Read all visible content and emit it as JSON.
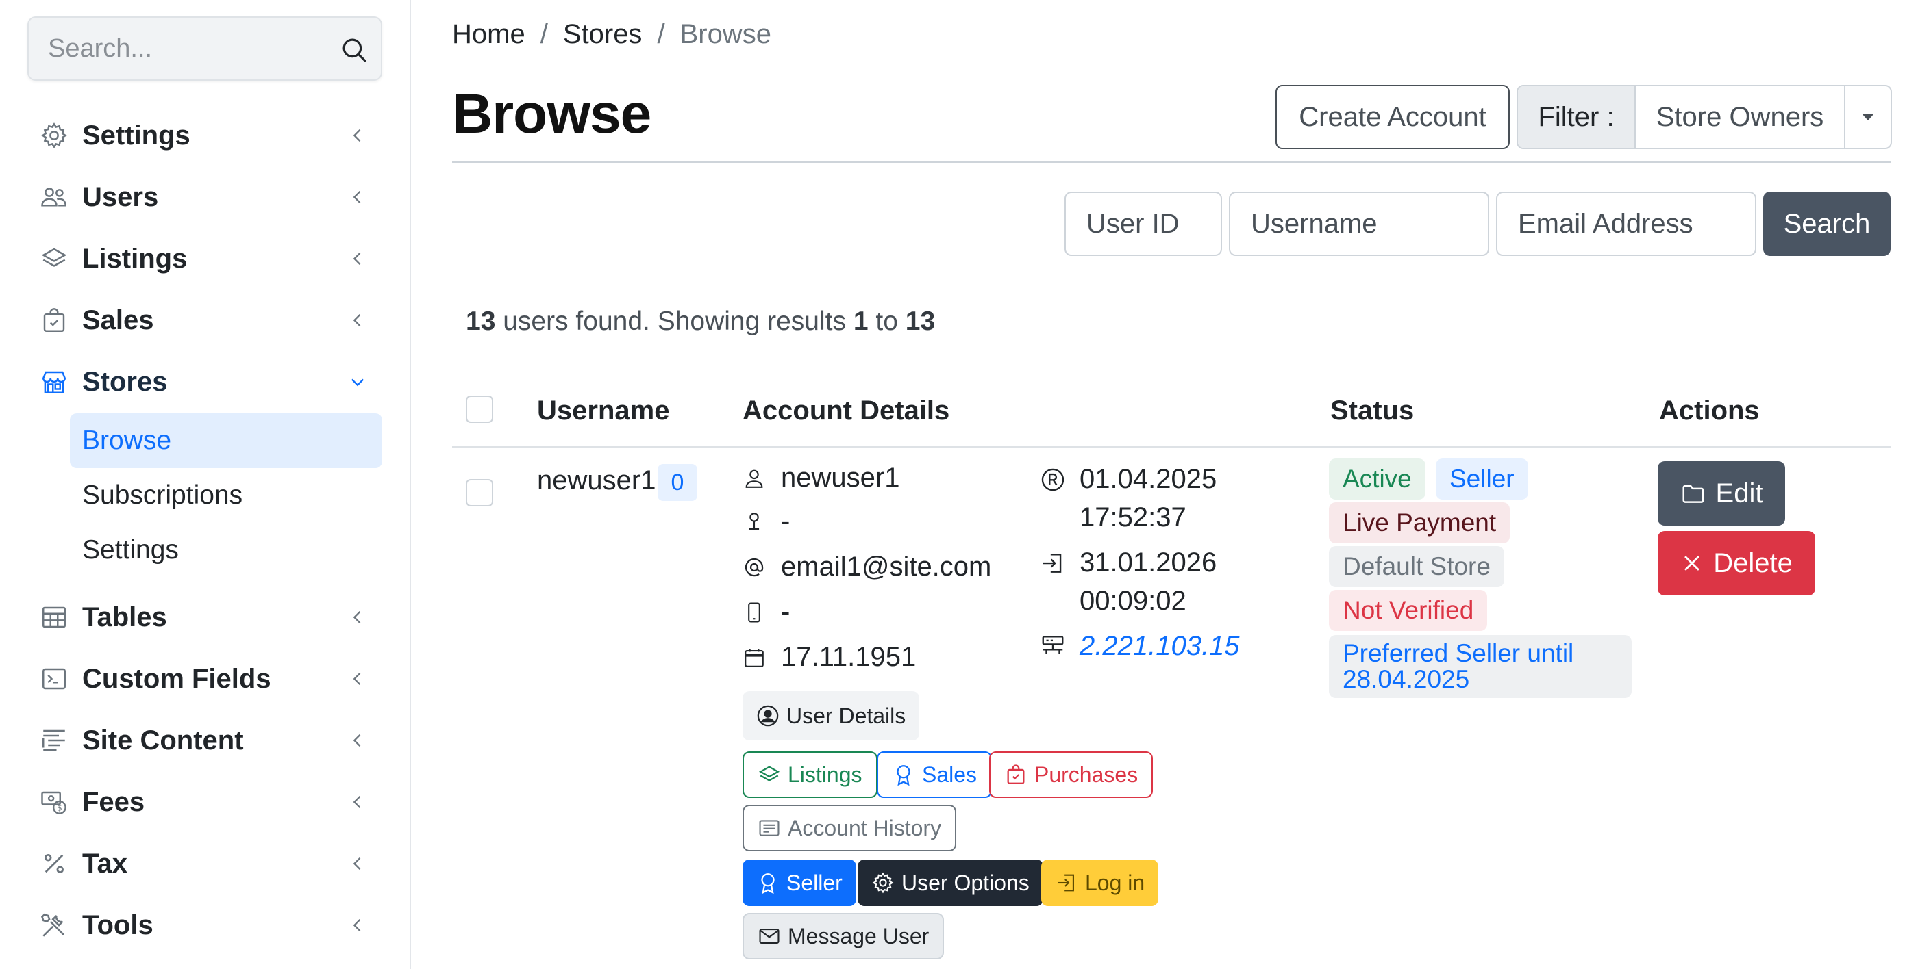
{
  "sidebar": {
    "search_placeholder": "Search...",
    "items": [
      {
        "label": "Settings",
        "icon": "gear-icon"
      },
      {
        "label": "Users",
        "icon": "users-icon"
      },
      {
        "label": "Listings",
        "icon": "layers-icon"
      },
      {
        "label": "Sales",
        "icon": "bag-check-icon"
      },
      {
        "label": "Stores",
        "icon": "shop-icon"
      },
      {
        "label": "Tables",
        "icon": "table-icon"
      },
      {
        "label": "Custom Fields",
        "icon": "terminal-icon"
      },
      {
        "label": "Site Content",
        "icon": "text-indent-icon"
      },
      {
        "label": "Fees",
        "icon": "cash-coin-icon"
      },
      {
        "label": "Tax",
        "icon": "percent-icon"
      },
      {
        "label": "Tools",
        "icon": "tools-icon"
      }
    ],
    "stores_sub": [
      {
        "label": "Browse"
      },
      {
        "label": "Subscriptions"
      },
      {
        "label": "Settings"
      }
    ]
  },
  "breadcrumb": {
    "home": "Home",
    "sep": "/",
    "stores": "Stores",
    "current": "Browse"
  },
  "page_title": "Browse",
  "toolbar": {
    "create_account": "Create Account",
    "filter_label": "Filter :",
    "filter_value": "Store Owners"
  },
  "search_form": {
    "user_id_placeholder": "User ID",
    "username_placeholder": "Username",
    "email_placeholder": "Email Address",
    "search_button": "Search"
  },
  "results": {
    "total": "13",
    "text1": " users found. Showing results ",
    "from": "1",
    "to_word": " to ",
    "to": "13"
  },
  "table": {
    "headers": {
      "username": "Username",
      "account_details": "Account Details",
      "status": "Status",
      "actions": "Actions"
    },
    "rows": [
      {
        "username": "newuser1",
        "count": "0",
        "details": {
          "name": "newuser1",
          "address": "-",
          "email": "email1@site.com",
          "phone": "-",
          "birthdate": "17.11.1951",
          "registered_date": "01.04.2025",
          "registered_time": "17:52:37",
          "last_login_date": "31.01.2026",
          "last_login_time": "00:09:02",
          "ip": "2.221.103.15"
        },
        "buttons": {
          "user_details": "User Details",
          "listings": "Listings",
          "sales": "Sales",
          "purchases": "Purchases",
          "account_history": "Account History",
          "seller": "Seller",
          "user_options": "User Options",
          "log_in": "Log in",
          "message_user": "Message User"
        },
        "status": {
          "active": "Active",
          "seller": "Seller",
          "live_payment": "Live Payment",
          "default_store": "Default Store",
          "not_verified": "Not Verified",
          "preferred_line1": "Preferred Seller until",
          "preferred_line2": "28.04.2025"
        },
        "actions": {
          "edit": "Edit",
          "delete": "Delete"
        }
      }
    ]
  },
  "colors": {
    "primary": "#0d6efd",
    "danger": "#dc3545",
    "success": "#198754",
    "dark": "#4a5563",
    "warning": "#ffcd39"
  }
}
